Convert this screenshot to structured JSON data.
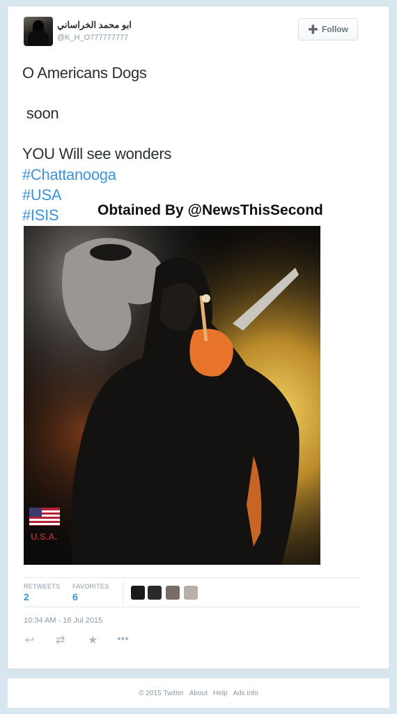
{
  "author": {
    "display_name": "ابو محمد الخراساني",
    "handle": "@K_H_O777777777",
    "avatar_icon": "masked-person-avatar"
  },
  "follow_button": {
    "label": "Follow",
    "icon": "add-user-icon"
  },
  "tweet": {
    "lines": [
      "O Americans Dogs",
      " soon",
      "YOU Will see wonders"
    ],
    "hashtags": [
      "#Chattanooga",
      "#USA",
      "#ISIS"
    ]
  },
  "watermark": "Obtained By @NewsThisSecond",
  "media": {
    "flag_label": "U.S.A.",
    "colors": {
      "accent_orange": "#e8732a",
      "fire_yellow": "#f3d060"
    }
  },
  "stats": {
    "retweets": {
      "label": "RETWEETS",
      "value": "2"
    },
    "favorites": {
      "label": "FAVORITES",
      "value": "6"
    }
  },
  "timestamp": "10:34 AM - 16 Jul 2015",
  "actions": [
    "reply-icon",
    "retweet-icon",
    "favorite-icon",
    "more-icon"
  ],
  "footer": {
    "copyright": "© 2015 Twitter",
    "links": [
      "About",
      "Help",
      "Ads info"
    ]
  },
  "colors": {
    "link_blue": "#3b94d9",
    "text_dark": "#292f33",
    "muted": "#8899a6",
    "background": "#d8e6f0"
  }
}
